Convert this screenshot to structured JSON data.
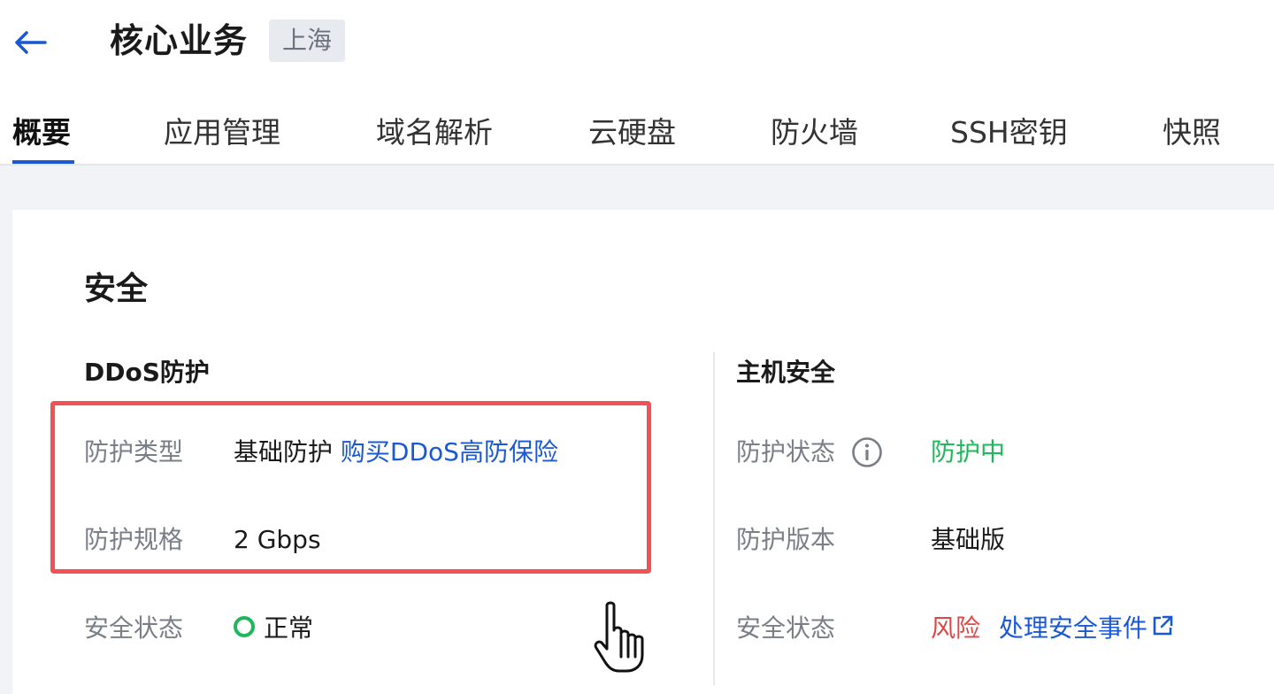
{
  "header": {
    "title": "核心业务",
    "region": "上海",
    "back_icon": "arrow-left-icon"
  },
  "tabs": [
    {
      "label": "概要",
      "active": true
    },
    {
      "label": "应用管理"
    },
    {
      "label": "域名解析"
    },
    {
      "label": "云硬盘"
    },
    {
      "label": "防火墙"
    },
    {
      "label": "SSH密钥"
    },
    {
      "label": "快照"
    }
  ],
  "security": {
    "title": "安全",
    "ddos": {
      "title": "DDoS防护",
      "type_label": "防护类型",
      "type_value": "基础防护",
      "buy_link": "购买DDoS高防保险",
      "spec_label": "防护规格",
      "spec_value": "2 Gbps",
      "status_label": "安全状态",
      "status_value": "正常"
    },
    "host": {
      "title": "主机安全",
      "protect_label": "防护状态",
      "protect_value": "防护中",
      "version_label": "防护版本",
      "version_value": "基础版",
      "status_label": "安全状态",
      "status_value": "风险",
      "handle_link": "处理安全事件"
    }
  },
  "colors": {
    "accent": "#1a58d4",
    "success": "#1fb75a",
    "danger": "#e04646",
    "highlight_border": "#f25256"
  },
  "icons": {
    "info": "info-circle-icon",
    "external": "external-link-icon",
    "cursor": "hand-pointer-icon"
  }
}
